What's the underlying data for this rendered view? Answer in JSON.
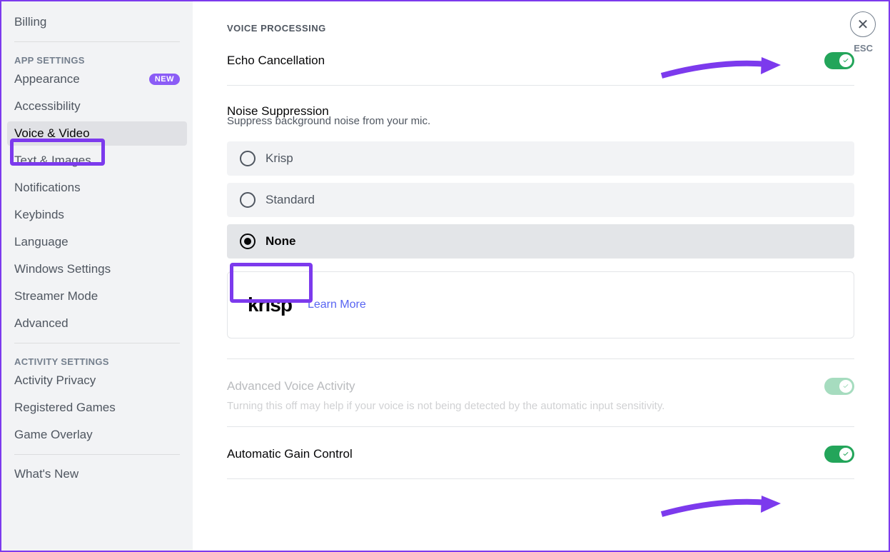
{
  "sidebar": {
    "items": [
      {
        "label": "Billing"
      }
    ],
    "app_header": "APP SETTINGS",
    "app_items": [
      {
        "label": "Appearance",
        "badge": "NEW"
      },
      {
        "label": "Accessibility"
      },
      {
        "label": "Voice & Video",
        "active": true
      },
      {
        "label": "Text & Images"
      },
      {
        "label": "Notifications"
      },
      {
        "label": "Keybinds"
      },
      {
        "label": "Language"
      },
      {
        "label": "Windows Settings"
      },
      {
        "label": "Streamer Mode"
      },
      {
        "label": "Advanced"
      }
    ],
    "activity_header": "ACTIVITY SETTINGS",
    "activity_items": [
      {
        "label": "Activity Privacy"
      },
      {
        "label": "Registered Games"
      },
      {
        "label": "Game Overlay"
      }
    ],
    "whats_new": "What's New"
  },
  "main": {
    "section_header": "VOICE PROCESSING",
    "echo": {
      "title": "Echo Cancellation",
      "on": true
    },
    "noise": {
      "title": "Noise Suppression",
      "desc": "Suppress background noise from your mic.",
      "options": [
        "Krisp",
        "Standard",
        "None"
      ],
      "selected": "None"
    },
    "krisp": {
      "logo": "krısp",
      "learn_more": "Learn More"
    },
    "advanced_voice": {
      "title": "Advanced Voice Activity",
      "desc": "Turning this off may help if your voice is not being detected by the automatic input sensitivity.",
      "on": true,
      "disabled": true
    },
    "agc": {
      "title": "Automatic Gain Control",
      "on": true
    }
  },
  "close": {
    "esc": "ESC"
  }
}
